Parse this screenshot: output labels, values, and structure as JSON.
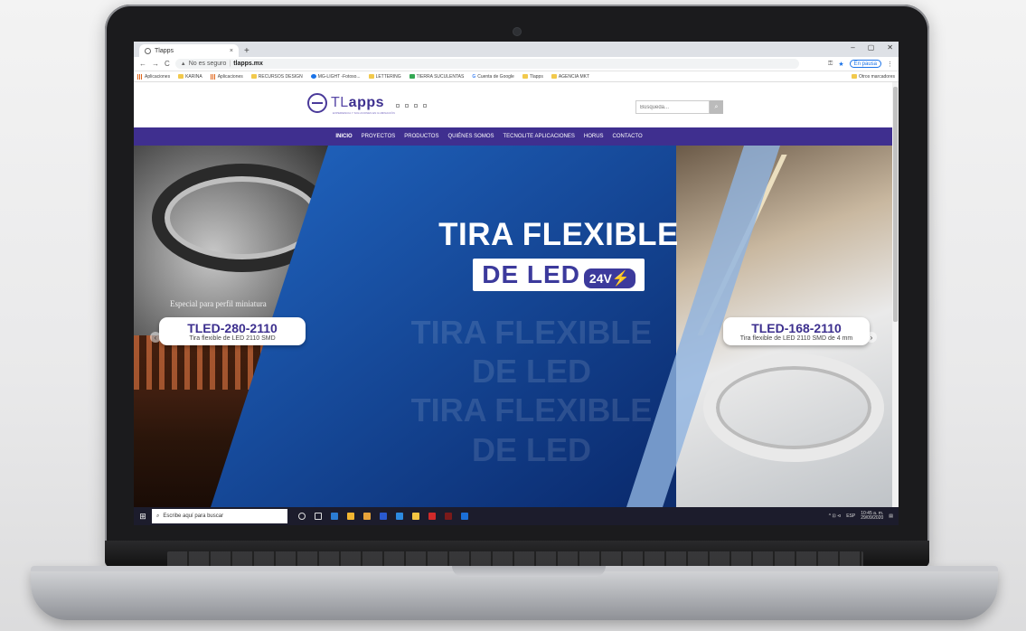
{
  "browser": {
    "tab_title": "Tlapps",
    "tab_close": "×",
    "new_tab": "+",
    "window_controls": [
      "–",
      "▢",
      "✕"
    ],
    "nav": {
      "back": "←",
      "forward": "→",
      "reload": "C"
    },
    "url_warning": "No es seguro",
    "url_host": "tlapps.mx",
    "paused_label": "En pausa",
    "bookmarks": [
      "Aplicaciones",
      "KARINA",
      "Aplicaciones",
      "RECURSOS DESIGN",
      "MG-LIGHT -Fotoso...",
      "LETTERING",
      "TIERRA SUCULENTAS",
      "Cuenta de Google",
      "Tlapps",
      "AGENCIA MKT"
    ],
    "other_bookmarks": "Otros marcadores"
  },
  "site": {
    "logo": {
      "part1": "TL",
      "part2": "apps",
      "subtitle": "EXPERIENCIA Y SOLUCIONES EN ILUMINACIÓN"
    },
    "search_placeholder": "Búsqueda...",
    "search_icon": "⌕",
    "menu": [
      "INICIO",
      "PROYECTOS",
      "PRODUCTOS",
      "QUIÉNES SOMOS",
      "TECNOLITE APLICACIONES",
      "HORUS",
      "CONTACTO"
    ],
    "hero": {
      "headline_line1": "TIRA FLEXIBLE",
      "headline_line2": "DE LED",
      "voltage": "24V",
      "bolt": "⚡",
      "ghost_line1": "TIRA FLEXIBLE",
      "ghost_line2": "DE LED",
      "ghost_line3": "TIRA FLEXIBLE",
      "ghost_line4": "DE LED",
      "special_text": "Especial para perfil miniatura",
      "left_card": {
        "code": "TLED-280-2110",
        "desc": "Tira flexible de LED 2110 SMD"
      },
      "right_card": {
        "code": "TLED-168-2110",
        "desc": "Tira flexible de LED 2110 SMD de 4 mm"
      },
      "arrow_left": "‹",
      "arrow_right": "›"
    }
  },
  "taskbar": {
    "start_icon": "⊞",
    "search_placeholder": "Escribe aquí para buscar",
    "tray_lang": "ESP",
    "time": "10:45 a. m.",
    "date": "29/09/2020",
    "tray_icons": "^ ⊡ ⊲"
  },
  "colors": {
    "brand_purple": "#3f2f8f",
    "hero_blue": "#0d2d6e",
    "taskbar": "#1c1c2c"
  }
}
